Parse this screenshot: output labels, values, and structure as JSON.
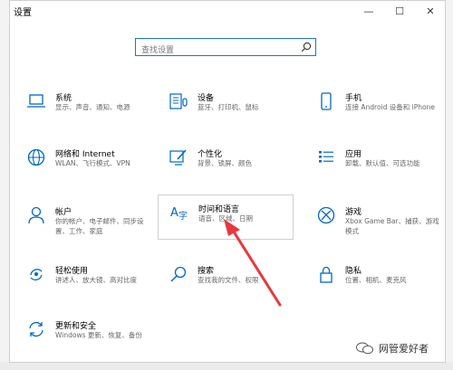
{
  "window": {
    "title": "设置"
  },
  "titlebar": {
    "minimize": "—",
    "maximize": "☐",
    "close": "✕"
  },
  "search": {
    "placeholder": "查找设置"
  },
  "tiles": [
    {
      "icon": "laptop-icon",
      "name": "系统",
      "desc": "显示、声音、通知、电源"
    },
    {
      "icon": "keyboard-icon",
      "name": "设备",
      "desc": "蓝牙、打印机、鼠标"
    },
    {
      "icon": "phone-icon",
      "name": "手机",
      "desc": "连接 Android 设备和 iPhone"
    },
    {
      "icon": "globe-icon",
      "name": "网络和 Internet",
      "desc": "WLAN、飞行模式、VPN"
    },
    {
      "icon": "paint-icon",
      "name": "个性化",
      "desc": "背景、锁屏、颜色"
    },
    {
      "icon": "apps-icon",
      "name": "应用",
      "desc": "卸载、默认值、可选功能"
    },
    {
      "icon": "person-icon",
      "name": "帐户",
      "desc": "你的帐户、电子邮件、同步设置、工作、家庭"
    },
    {
      "icon": "language-icon",
      "name": "时间和语言",
      "desc": "语音、区域、日期"
    },
    {
      "icon": "xbox-icon",
      "name": "游戏",
      "desc": "Xbox Game Bar、捕获、游戏模式"
    },
    {
      "icon": "accessibility-icon",
      "name": "轻松使用",
      "desc": "讲述人、放大镜、高对比度"
    },
    {
      "icon": "search-icon",
      "name": "搜索",
      "desc": "查找我的文件、权限"
    },
    {
      "icon": "lock-icon",
      "name": "隐私",
      "desc": "位置、相机、麦克风"
    },
    {
      "icon": "update-icon",
      "name": "更新和安全",
      "desc": "Windows 更新、恢复、备份"
    }
  ],
  "watermark": {
    "text": "网管爱好者"
  },
  "colors": {
    "accent": "#0067c0",
    "search_border": "#1976d2",
    "arrow": "#e8383d"
  }
}
